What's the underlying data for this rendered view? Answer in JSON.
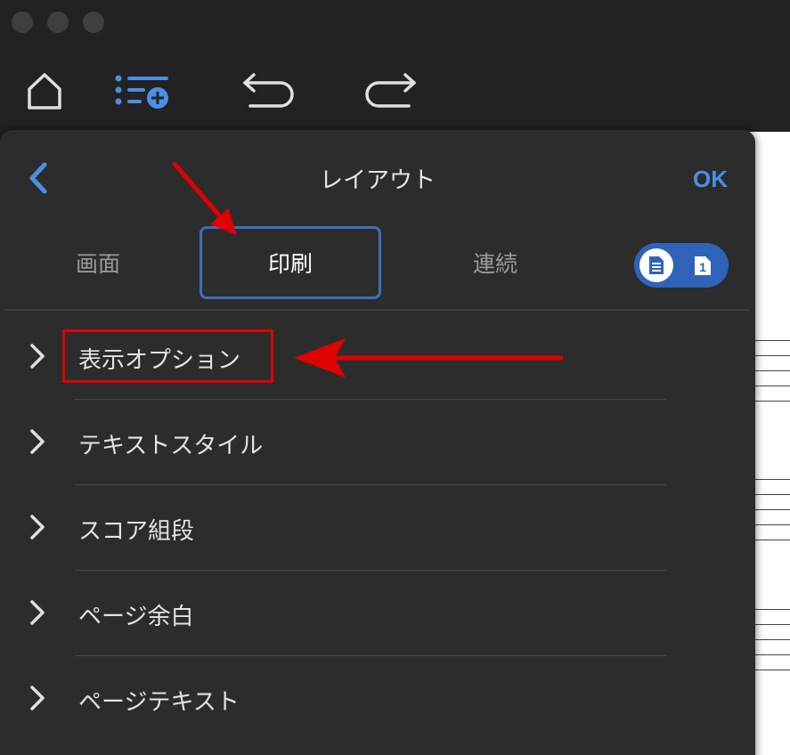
{
  "window": {
    "traffic_lights": [
      "close",
      "minimize",
      "zoom"
    ]
  },
  "toolbar": {
    "buttons": [
      {
        "icon": "home-icon"
      },
      {
        "icon": "add-list-icon"
      },
      {
        "icon": "undo-icon"
      },
      {
        "icon": "redo-icon"
      }
    ]
  },
  "panel": {
    "title": "レイアウト",
    "ok_label": "OK",
    "tabs": [
      {
        "label": "画面",
        "active": false
      },
      {
        "label": "印刷",
        "active": true
      },
      {
        "label": "連続",
        "active": false
      }
    ],
    "toggle": {
      "left_icon": "document-icon",
      "right_icon": "single-page-icon",
      "right_number": "1"
    },
    "sections": [
      {
        "label": "表示オプション",
        "highlighted": true
      },
      {
        "label": "テキストスタイル"
      },
      {
        "label": "スコア組段"
      },
      {
        "label": "ページ余白"
      },
      {
        "label": "ページテキスト"
      }
    ]
  },
  "colors": {
    "accent": "#4a8ee6",
    "tab_border": "#3a6fc0",
    "toggle": "#2f63b8",
    "annotation": "#e00000",
    "panel_bg": "#2c2c2c",
    "window_bg": "#222222"
  }
}
